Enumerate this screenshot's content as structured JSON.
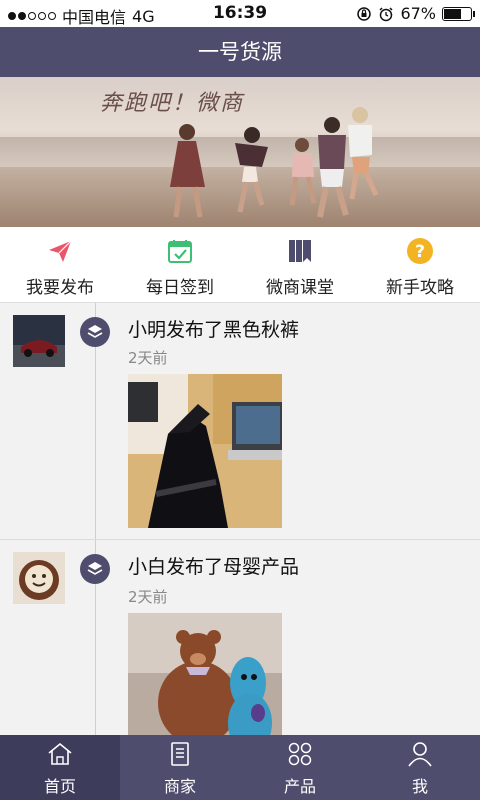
{
  "status_bar": {
    "carrier": "中国电信",
    "network": "4G",
    "time": "16:39",
    "battery": "67%",
    "battery_level": 0.67,
    "signal_bars": 2
  },
  "nav": {
    "title": "一号货源"
  },
  "banner": {
    "slogan": "奔跑吧！微商"
  },
  "menu": [
    {
      "label": "我要发布",
      "icon": "paper-plane-icon",
      "color": "#e8566b"
    },
    {
      "label": "每日签到",
      "icon": "calendar-check-icon",
      "color": "#3ebf74"
    },
    {
      "label": "微商课堂",
      "icon": "books-icon",
      "color": "#4f4d6e"
    },
    {
      "label": "新手攻略",
      "icon": "question-circle-icon",
      "color": "#f2b422"
    }
  ],
  "posts": [
    {
      "title": "小明发布了黑色秋裤",
      "time": "2天前"
    },
    {
      "title": "小白发布了母婴产品",
      "time": "2天前"
    }
  ],
  "tabs": [
    {
      "label": "首页",
      "icon": "home-icon",
      "active": true
    },
    {
      "label": "商家",
      "icon": "document-icon",
      "active": false
    },
    {
      "label": "产品",
      "icon": "grid-icon",
      "active": false
    },
    {
      "label": "我",
      "icon": "user-icon",
      "active": false
    }
  ],
  "colors": {
    "theme": "#4f4d6e",
    "theme_dark": "#3e3c5b"
  }
}
